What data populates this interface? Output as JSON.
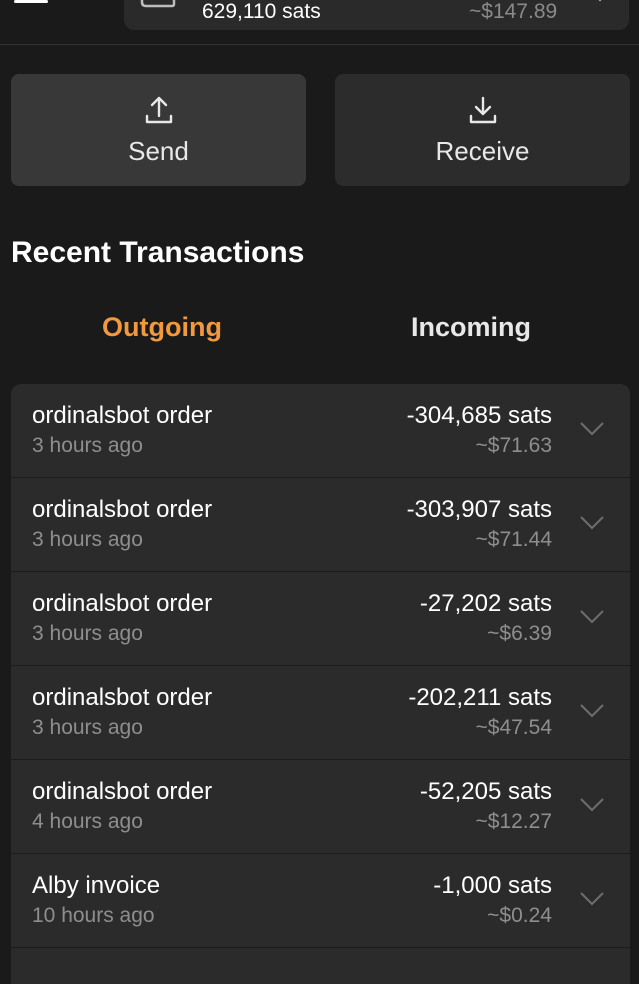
{
  "header": {
    "balance_sats": "629,110 sats",
    "balance_usd": "~$147.89"
  },
  "actions": {
    "send_label": "Send",
    "receive_label": "Receive"
  },
  "section_title": "Recent Transactions",
  "tabs": {
    "outgoing": "Outgoing",
    "incoming": "Incoming",
    "active": "outgoing",
    "active_color": "#f0993e"
  },
  "transactions": [
    {
      "title": "ordinalsbot order",
      "time": "3 hours ago",
      "amount": "-304,685 sats",
      "usd": "~$71.63"
    },
    {
      "title": "ordinalsbot order",
      "time": "3 hours ago",
      "amount": "-303,907 sats",
      "usd": "~$71.44"
    },
    {
      "title": "ordinalsbot order",
      "time": "3 hours ago",
      "amount": "-27,202 sats",
      "usd": "~$6.39"
    },
    {
      "title": "ordinalsbot order",
      "time": "3 hours ago",
      "amount": "-202,211 sats",
      "usd": "~$47.54"
    },
    {
      "title": "ordinalsbot order",
      "time": "4 hours ago",
      "amount": "-52,205 sats",
      "usd": "~$12.27"
    },
    {
      "title": "Alby invoice",
      "time": "10 hours ago",
      "amount": "-1,000 sats",
      "usd": "~$0.24"
    }
  ],
  "icons": {
    "menu": "menu-icon",
    "wallet": "wallet-icon",
    "send": "upload-icon",
    "receive": "download-icon",
    "expand": "chevron-down-icon"
  }
}
